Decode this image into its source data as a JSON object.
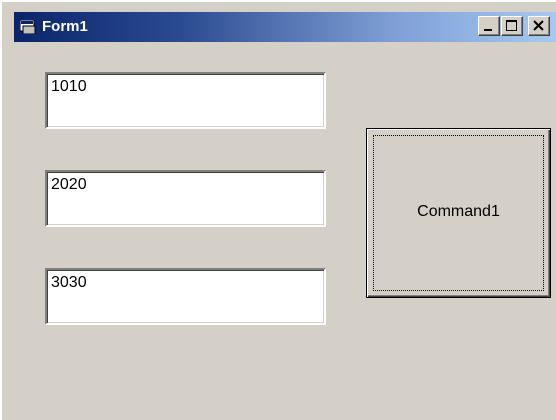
{
  "window": {
    "title": "Form1",
    "controls": [
      "minimize",
      "maximize",
      "close"
    ]
  },
  "textboxes": [
    {
      "value": "1010"
    },
    {
      "value": "2020"
    },
    {
      "value": "3030"
    }
  ],
  "command_button": {
    "label": "Command1"
  },
  "colors": {
    "titlebar_start": "#0a246a",
    "titlebar_end": "#a6caf0",
    "form_background": "#d4d0c8",
    "textbox_background": "#ffffff"
  }
}
